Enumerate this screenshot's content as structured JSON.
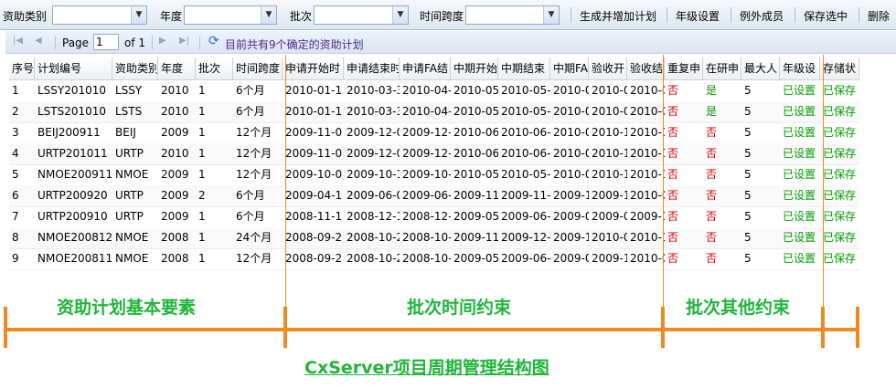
{
  "toolbar": {
    "labels": [
      "资助类别",
      "年度",
      "批次",
      "时间跨度"
    ],
    "buttons": [
      "生成并增加计划",
      "年级设置",
      "例外成员",
      "保存选中",
      "删除"
    ]
  },
  "pager": {
    "page_label": "Page",
    "page_value": "1",
    "of_label": "of 1",
    "status": "目前共有9个确定的资助计划"
  },
  "grid": {
    "columns": [
      "序号",
      "计划编号",
      "资助类别",
      "年度",
      "批次",
      "时间跨度",
      "申请开始时",
      "申请结束时",
      "申请FA结",
      "中期开始",
      "中期结束",
      "中期FA",
      "验收开",
      "验收结",
      "重复申",
      "在研申",
      "最大人",
      "年级设",
      "存储状"
    ],
    "rows": [
      [
        "1",
        "LSSY201010",
        "LSSY",
        "2010",
        "1",
        "6个月",
        "2010-01-1",
        "2010-03-3",
        "2010-04-",
        "2010-05",
        "2010-05-",
        "2010-0",
        "2010-0",
        "2010-0",
        "否",
        "是",
        "5",
        "已设置",
        "已保存"
      ],
      [
        "2",
        "LSTS201010",
        "LSTS",
        "2010",
        "1",
        "6个月",
        "2010-01-1",
        "2010-03-3",
        "2010-04-",
        "2010-05",
        "2010-05-",
        "2010-0",
        "2010-0",
        "2010-0",
        "否",
        "是",
        "5",
        "已设置",
        "已保存"
      ],
      [
        "3",
        "BEIJ200911",
        "BEIJ",
        "2009",
        "1",
        "12个月",
        "2009-11-0",
        "2009-12-0",
        "2009-12-",
        "2010-06",
        "2010-06-",
        "2010-0",
        "2010-1",
        "2010-1",
        "否",
        "否",
        "5",
        "已设置",
        "已保存"
      ],
      [
        "4",
        "URTP201011",
        "URTP",
        "2010",
        "1",
        "12个月",
        "2009-11-0",
        "2009-12-0",
        "2009-12-",
        "2010-06",
        "2010-06-",
        "2010-0",
        "2010-1",
        "2010-1",
        "否",
        "否",
        "5",
        "已设置",
        "已保存"
      ],
      [
        "5",
        "NMOE200911",
        "NMOE",
        "2009",
        "1",
        "12个月",
        "2009-10-0",
        "2009-10-1",
        "2009-10-",
        "2010-05",
        "2010-05-",
        "2010-0",
        "2010-1",
        "2010-1",
        "否",
        "否",
        "5",
        "已设置",
        "已保存"
      ],
      [
        "6",
        "URTP200920",
        "URTP",
        "2009",
        "2",
        "6个月",
        "2009-04-1",
        "2009-06-0",
        "2009-06-",
        "2009-11",
        "2009-11-",
        "2009-1",
        "2009-1",
        "2010-0",
        "否",
        "否",
        "5",
        "已设置",
        "已保存"
      ],
      [
        "7",
        "URTP200910",
        "URTP",
        "2009",
        "1",
        "6个月",
        "2008-11-1",
        "2008-12-1",
        "2008-12-",
        "2009-05",
        "2009-06-",
        "2009-0",
        "2009-0",
        "2009-1",
        "否",
        "否",
        "5",
        "已设置",
        "已保存"
      ],
      [
        "8",
        "NMOE200812",
        "NMOE",
        "2008",
        "1",
        "24个月",
        "2008-09-2",
        "2008-10-2",
        "2008-10-",
        "2009-11",
        "2009-12-",
        "2009-1",
        "2010-0",
        "2010-1",
        "否",
        "否",
        "5",
        "已设置",
        "已保存"
      ],
      [
        "9",
        "NMOE200811",
        "NMOE",
        "2008",
        "1",
        "12个月",
        "2008-09-2",
        "2008-10-2",
        "2008-10-",
        "2009-05",
        "2009-06-",
        "2009-0",
        "2009-1",
        "2010-0",
        "否",
        "否",
        "5",
        "已设置",
        "已保存"
      ]
    ]
  },
  "annotations": {
    "sections": [
      "资助计划基本要素",
      "批次时间约束",
      "批次其他约束"
    ],
    "caption": "CxServer项目周期管理结构图",
    "colors": {
      "line": "#f08a1e",
      "label": "#1fb63a",
      "no": "#e00000",
      "yes": "#109010"
    }
  },
  "icons": [
    "chevron-down-icon",
    "first-page-icon",
    "prev-page-icon",
    "next-page-icon",
    "last-page-icon",
    "refresh-icon"
  ]
}
